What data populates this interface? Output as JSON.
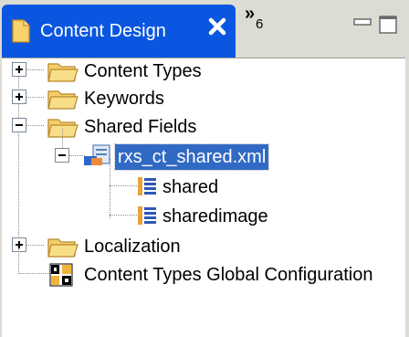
{
  "tab": {
    "title": "Content Design",
    "close_icon": "close-icon",
    "overflow_count": "6",
    "active_color": "#0a56e0"
  },
  "tree": {
    "items": [
      {
        "label": "Content Types",
        "icon": "folder-icon",
        "expander": "plus"
      },
      {
        "label": "Keywords",
        "icon": "folder-icon",
        "expander": "plus"
      },
      {
        "label": "Shared Fields",
        "icon": "folder-icon",
        "expander": "minus"
      },
      {
        "label": "rxs_ct_shared.xml",
        "icon": "xml-file-icon",
        "expander": "minus",
        "selected": true
      },
      {
        "label": "shared",
        "icon": "field-set-icon"
      },
      {
        "label": "sharedimage",
        "icon": "field-set-icon"
      },
      {
        "label": "Localization",
        "icon": "folder-icon",
        "expander": "plus"
      },
      {
        "label": "Content Types Global Configuration",
        "icon": "config-file-icon"
      }
    ]
  }
}
